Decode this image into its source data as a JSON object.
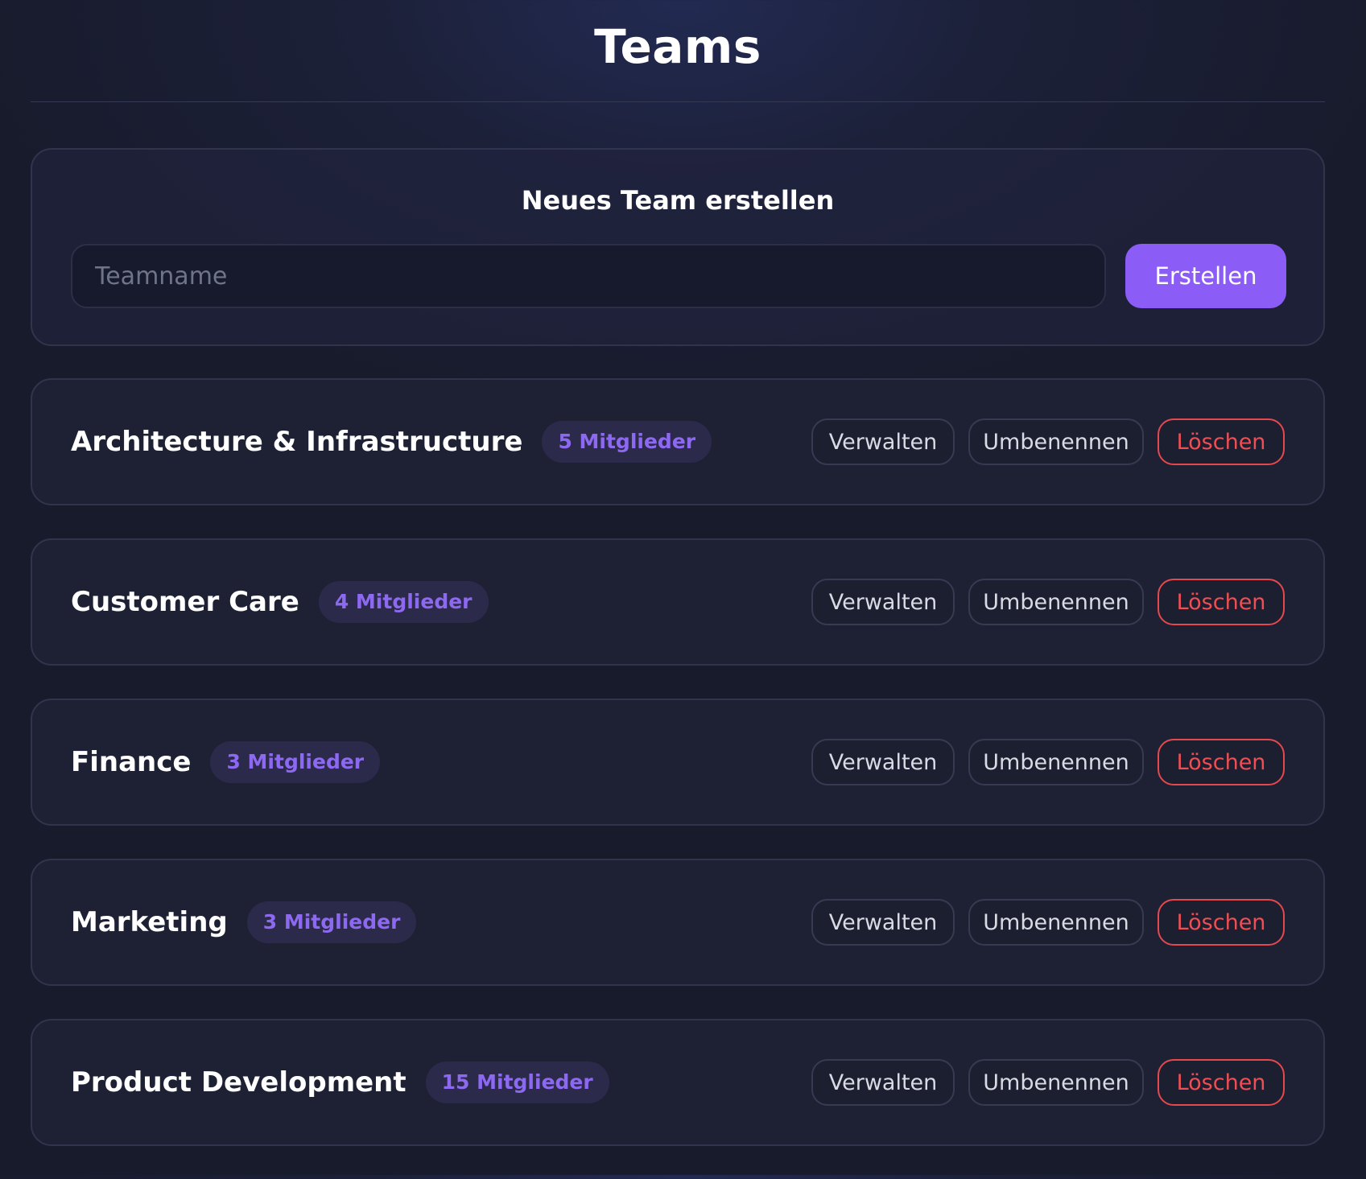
{
  "header": {
    "title": "Teams"
  },
  "create": {
    "title": "Neues Team erstellen",
    "input_placeholder": "Teamname",
    "input_value": "",
    "button_label": "Erstellen"
  },
  "actions": {
    "manage_label": "Verwalten",
    "rename_label": "Umbenennen",
    "delete_label": "Löschen"
  },
  "teams": [
    {
      "name": "Architecture & Infrastructure",
      "members": "5 Mitglieder"
    },
    {
      "name": "Customer Care",
      "members": "4 Mitglieder"
    },
    {
      "name": "Finance",
      "members": "3 Mitglieder"
    },
    {
      "name": "Marketing",
      "members": "3 Mitglieder"
    },
    {
      "name": "Product Development",
      "members": "15 Mitglieder"
    }
  ],
  "colors": {
    "accent": "#8b5cf6",
    "danger": "#ef4f54",
    "background": "#181b2c",
    "card": "#1e2134"
  }
}
